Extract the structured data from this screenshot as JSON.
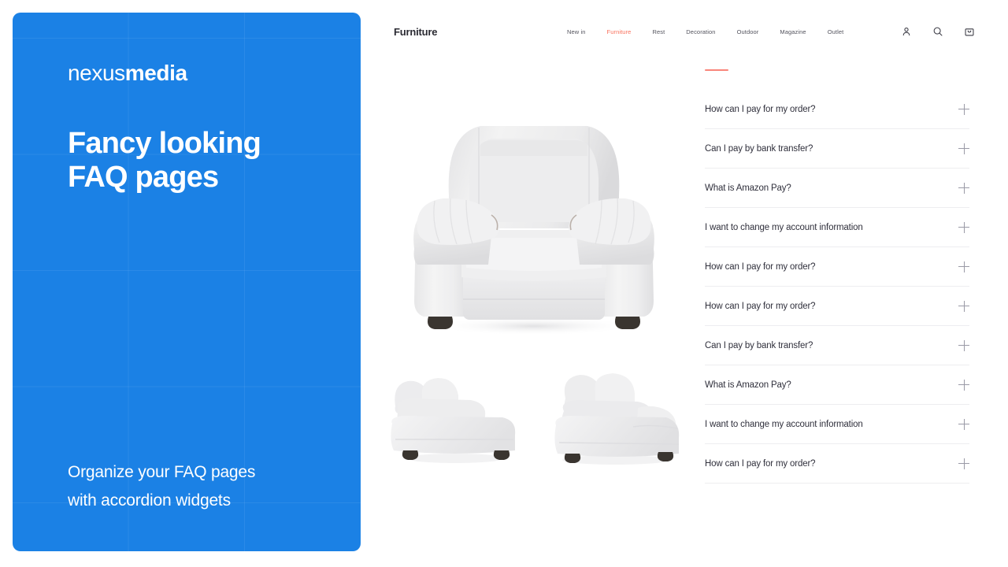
{
  "promo": {
    "brand_thin": "nexus",
    "brand_bold": "media",
    "headline_line1": "Fancy looking",
    "headline_line2": "FAQ pages",
    "subtext_line1": "Organize your FAQ pages",
    "subtext_line2": "with accordion widgets",
    "background_color": "#1B81E5"
  },
  "site": {
    "logo": "Furniture",
    "nav": [
      {
        "label": "New in",
        "active": false
      },
      {
        "label": "Furniture",
        "active": true
      },
      {
        "label": "Rest",
        "active": false
      },
      {
        "label": "Decoration",
        "active": false
      },
      {
        "label": "Outdoor",
        "active": false
      },
      {
        "label": "Magazine",
        "active": false
      },
      {
        "label": "Outlet",
        "active": false
      }
    ],
    "nav_active_color": "#F9705C",
    "icons": [
      {
        "name": "account-icon",
        "glyph": "person"
      },
      {
        "name": "search-icon",
        "glyph": "magnifier"
      },
      {
        "name": "cart-icon",
        "glyph": "shopping-bag"
      }
    ],
    "gallery": {
      "hero_alt": "white leather armchair front view",
      "thumbnails": [
        {
          "alt": "white leather armchair side view"
        },
        {
          "alt": "white leather armchair three quarter view"
        }
      ]
    },
    "faq": {
      "accent_color": "#F9857A",
      "expand_icon": "plus-icon",
      "items": [
        {
          "question": "How can I pay for my order?"
        },
        {
          "question": "Can I pay by bank transfer?"
        },
        {
          "question": "What is Amazon Pay?"
        },
        {
          "question": "I want to change my account information"
        },
        {
          "question": "How can I pay for my order?"
        },
        {
          "question": "How can I pay for my order?"
        },
        {
          "question": "Can I pay by bank transfer?"
        },
        {
          "question": "What is Amazon Pay?"
        },
        {
          "question": "I want to change my account information"
        },
        {
          "question": "How can I pay for my order?"
        }
      ]
    }
  }
}
